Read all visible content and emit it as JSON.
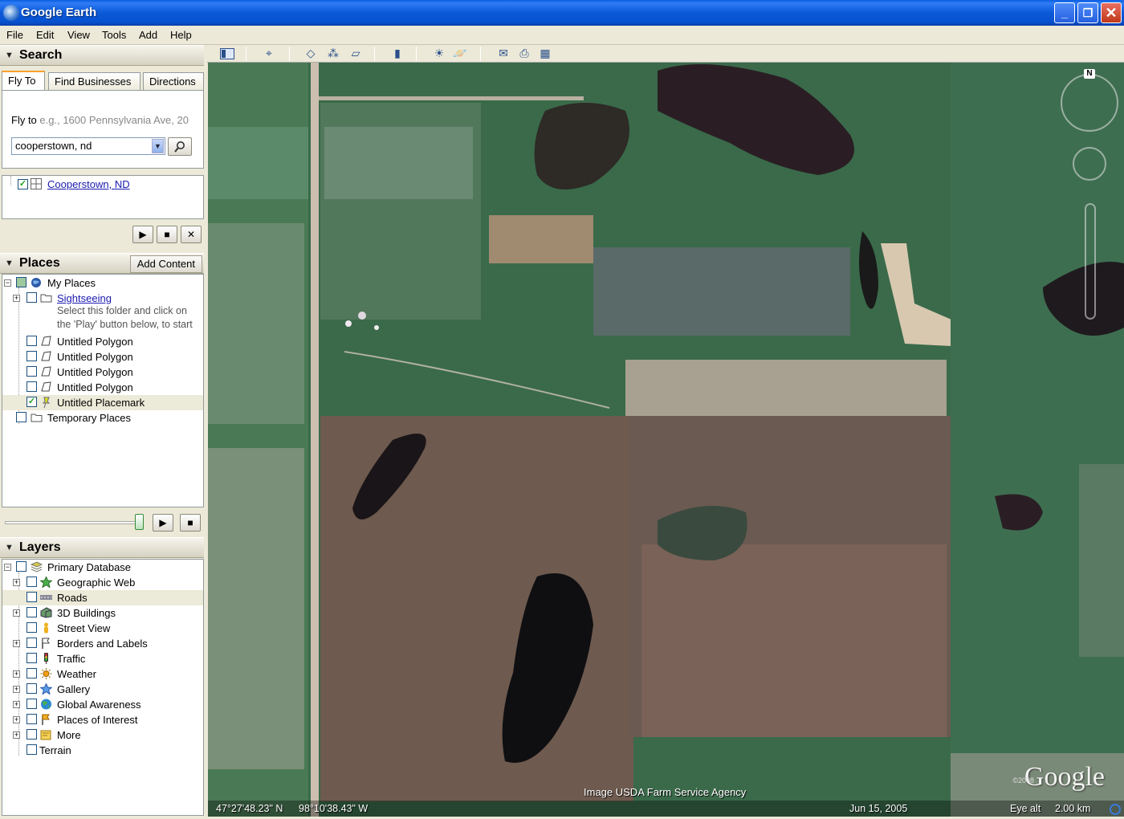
{
  "window": {
    "title": "Google Earth",
    "minimize_glyph": "_",
    "maximize_glyph": "❐",
    "close_glyph": "✕"
  },
  "menu": [
    "File",
    "Edit",
    "View",
    "Tools",
    "Add",
    "Help"
  ],
  "search": {
    "header": "Search",
    "tabs": [
      "Fly To",
      "Find Businesses",
      "Directions"
    ],
    "flyto_label": "Fly to",
    "flyto_hint": "e.g., 1600 Pennsylvania Ave, 20",
    "query": "cooperstown, nd",
    "result": "Cooperstown, ND"
  },
  "places": {
    "header": "Places",
    "add_content": "Add Content",
    "items": [
      {
        "label": "My Places",
        "checked": false
      },
      {
        "label": "Sightseeing",
        "checked": false,
        "link": true
      },
      {
        "label": "Untitled Polygon",
        "checked": false
      },
      {
        "label": "Untitled Polygon",
        "checked": false
      },
      {
        "label": "Untitled Polygon",
        "checked": false
      },
      {
        "label": "Untitled Polygon",
        "checked": false
      },
      {
        "label": "Untitled Placemark",
        "checked": true
      },
      {
        "label": "Temporary Places",
        "checked": false
      }
    ],
    "sightseeing_desc_1": "Select this folder and click on",
    "sightseeing_desc_2": "the 'Play' button below, to start"
  },
  "layers": {
    "header": "Layers",
    "items": [
      {
        "label": "Primary Database",
        "icon": "database-icon"
      },
      {
        "label": "Geographic Web",
        "icon": "star-icon"
      },
      {
        "label": "Roads",
        "icon": "road-icon"
      },
      {
        "label": "3D Buildings",
        "icon": "building-icon"
      },
      {
        "label": "Street View",
        "icon": "person-icon"
      },
      {
        "label": "Borders and Labels",
        "icon": "flag-icon"
      },
      {
        "label": "Traffic",
        "icon": "traffic-light-icon"
      },
      {
        "label": "Weather",
        "icon": "sun-icon"
      },
      {
        "label": "Gallery",
        "icon": "star-icon"
      },
      {
        "label": "Global Awareness",
        "icon": "globe-icon"
      },
      {
        "label": "Places of Interest",
        "icon": "flag-icon"
      },
      {
        "label": "More",
        "icon": "folder-icon"
      },
      {
        "label": "Terrain",
        "icon": ""
      }
    ]
  },
  "map": {
    "latitude": "47°27'48.23\" N",
    "longitude": "98°10'38.43\" W",
    "imagery_credit": "Image USDA Farm Service Agency",
    "imagery_date": "Jun 15, 2005",
    "eye_alt_label": "Eye alt",
    "eye_alt_value": "2.00 km",
    "logo": "Google",
    "logo_copyright": "©2008",
    "compass_north": "N"
  },
  "colors": {
    "titlebar": "#0b58d8",
    "chrome": "#ece9d8",
    "link": "#1a1ab0"
  }
}
